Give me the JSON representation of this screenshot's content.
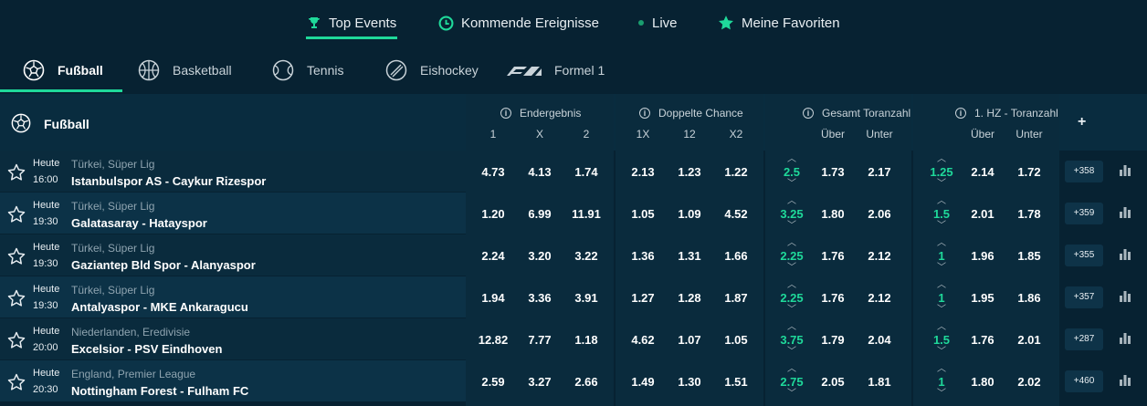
{
  "topnav": {
    "items": [
      {
        "label": "Top Events",
        "icon": "trophy-icon"
      },
      {
        "label": "Kommende Ereignisse",
        "icon": "clock-icon"
      },
      {
        "label": "Live",
        "icon": "live-dot-icon"
      },
      {
        "label": "Meine Favoriten",
        "icon": "star-icon"
      }
    ]
  },
  "sports": {
    "items": [
      {
        "label": "Fußball",
        "icon": "soccer-ball-icon"
      },
      {
        "label": "Basketball",
        "icon": "basketball-icon"
      },
      {
        "label": "Tennis",
        "icon": "tennis-ball-icon"
      },
      {
        "label": "Eishockey",
        "icon": "hockey-puck-icon"
      },
      {
        "label": "Formel 1",
        "icon": "f1-logo-icon"
      }
    ]
  },
  "table": {
    "title": "Fußball",
    "groups": [
      "Endergebnis",
      "Doppelte Chance",
      "Gesamt Toranzahl",
      "1. HZ - Toranzahl"
    ],
    "cols": {
      "endergebnis": [
        "1",
        "X",
        "2"
      ],
      "doppelte": [
        "1X",
        "12",
        "X2"
      ],
      "gesamt": [
        "Über",
        "Unter"
      ],
      "hz": [
        "Über",
        "Unter"
      ]
    },
    "plus": "+",
    "rows": [
      {
        "day": "Heute",
        "time": "16:00",
        "league": "Türkei, Süper Lig",
        "teams": "Istanbulspor AS  -  Caykur Rizespor",
        "e1": "4.73",
        "ex": "4.13",
        "e2": "1.74",
        "d1x": "2.13",
        "d12": "1.23",
        "dx2": "1.22",
        "gline": "2.5",
        "guber": "1.73",
        "gunter": "2.17",
        "hline": "1.25",
        "huber": "2.14",
        "hunter": "1.72",
        "more": "+358"
      },
      {
        "day": "Heute",
        "time": "19:30",
        "league": "Türkei, Süper Lig",
        "teams": "Galatasaray  -  Hatayspor",
        "e1": "1.20",
        "ex": "6.99",
        "e2": "11.91",
        "d1x": "1.05",
        "d12": "1.09",
        "dx2": "4.52",
        "gline": "3.25",
        "guber": "1.80",
        "gunter": "2.06",
        "hline": "1.5",
        "huber": "2.01",
        "hunter": "1.78",
        "more": "+359"
      },
      {
        "day": "Heute",
        "time": "19:30",
        "league": "Türkei, Süper Lig",
        "teams": "Gaziantep Bld Spor  -  Alanyaspor",
        "e1": "2.24",
        "ex": "3.20",
        "e2": "3.22",
        "d1x": "1.36",
        "d12": "1.31",
        "dx2": "1.66",
        "gline": "2.25",
        "guber": "1.76",
        "gunter": "2.12",
        "hline": "1",
        "huber": "1.96",
        "hunter": "1.85",
        "more": "+355"
      },
      {
        "day": "Heute",
        "time": "19:30",
        "league": "Türkei, Süper Lig",
        "teams": "Antalyaspor  -  MKE Ankaragucu",
        "e1": "1.94",
        "ex": "3.36",
        "e2": "3.91",
        "d1x": "1.27",
        "d12": "1.28",
        "dx2": "1.87",
        "gline": "2.25",
        "guber": "1.76",
        "gunter": "2.12",
        "hline": "1",
        "huber": "1.95",
        "hunter": "1.86",
        "more": "+357"
      },
      {
        "day": "Heute",
        "time": "20:00",
        "league": "Niederlanden, Eredivisie",
        "teams": "Excelsior  -  PSV Eindhoven",
        "e1": "12.82",
        "ex": "7.77",
        "e2": "1.18",
        "d1x": "4.62",
        "d12": "1.07",
        "dx2": "1.05",
        "gline": "3.75",
        "guber": "1.79",
        "gunter": "2.04",
        "hline": "1.5",
        "huber": "1.76",
        "hunter": "2.01",
        "more": "+287"
      },
      {
        "day": "Heute",
        "time": "20:30",
        "league": "England, Premier League",
        "teams": "Nottingham Forest  -  Fulham FC",
        "e1": "2.59",
        "ex": "3.27",
        "e2": "2.66",
        "d1x": "1.49",
        "d12": "1.30",
        "dx2": "1.51",
        "gline": "2.75",
        "guber": "2.05",
        "gunter": "1.81",
        "hline": "1",
        "huber": "1.80",
        "hunter": "2.02",
        "more": "+460"
      }
    ]
  },
  "colors": {
    "background": "#072232",
    "accent": "#1fd99a",
    "panel": "#0b2f44"
  }
}
